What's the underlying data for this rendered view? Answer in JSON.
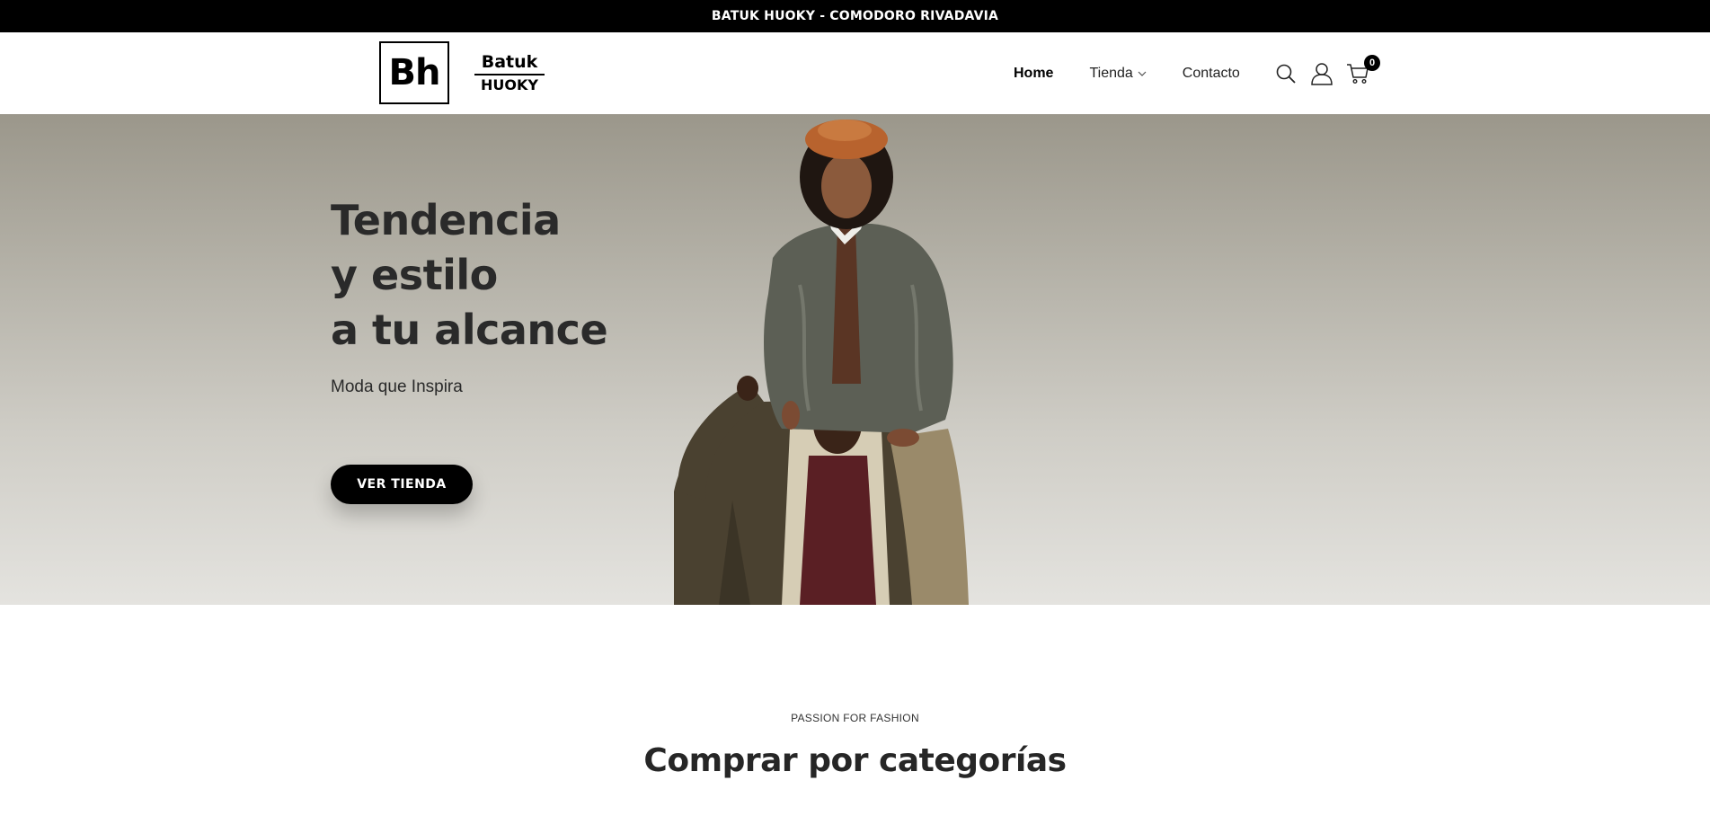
{
  "announcement": {
    "text": "BATUK HUOKY - COMODORO RIVADAVIA"
  },
  "brand": {
    "monogram": "Bh",
    "name_top": "Batuk",
    "name_bottom": "HUOKY"
  },
  "nav": {
    "items": [
      {
        "label": "Home"
      },
      {
        "label": "Tienda"
      },
      {
        "label": "Contacto"
      }
    ]
  },
  "header_icons": {
    "search": "search-icon",
    "account": "user-icon",
    "cart": "cart-icon",
    "cart_count": "0"
  },
  "hero": {
    "title_lines": [
      "Tendencia",
      "y estilo",
      "a tu alcance"
    ],
    "subtitle": "Moda que Inspira",
    "cta_label": "VER TIENDA"
  },
  "categories_section": {
    "kicker": "PASSION FOR FASHION",
    "title": "Comprar por categorías"
  },
  "colors": {
    "announcement_bg": "#000000",
    "hero_bg_top": "#9b978b",
    "hero_bg_bottom": "#e4e3df",
    "cta_bg": "#000000",
    "text_dark": "#2a2a2a"
  }
}
